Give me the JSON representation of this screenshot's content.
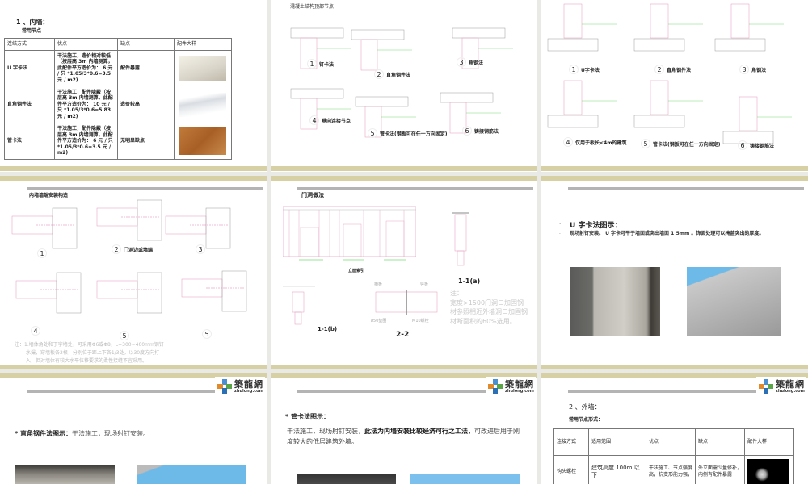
{
  "slides": [
    {
      "title": "1 、内墙：",
      "subtitle": "常用节点",
      "table": {
        "headers": [
          "连结方式",
          "优点",
          "缺点",
          "配件大样"
        ],
        "rows": [
          {
            "method": "U 字卡法",
            "pros": "干法施工，造价相对较低（按层高 3m 内墙测算，此配件平方造价为： 6 元 / 只 *1.05/3*0.6=3.5 元 / m2)",
            "cons": "配件暴露",
            "image": "u-clip"
          },
          {
            "method": "直角钢件法",
            "pros": "干法施工，配件隐蔽（按层高 3m 内墙测算，此配件平方造价为： 10 元 / 只 *1.05/3*0.6=5.83 元 / m2)",
            "cons": "造价较高",
            "image": "angle-steel"
          },
          {
            "method": "管卡法",
            "pros": "干法施工，配件隐蔽（按层高 3m 内墙测算，此配件平方造价为： 6 元 / 只 *1.05/3*0.6=3.5 元 / m2)",
            "cons": "无明显缺点",
            "image": "pipe-clip"
          }
        ]
      }
    },
    {
      "title": "混凝土结构顶部节点：",
      "captions": [
        "1",
        "钉卡法",
        "2",
        "直角钢件法",
        "3",
        "角钢法",
        "4",
        "垂向连接节点",
        "5",
        "管卡法(钢板可在任一方向固定)",
        "6",
        "铸接钢筋法"
      ]
    },
    {
      "captions": [
        "1",
        "U字卡法",
        "2",
        "直角钢件法",
        "3",
        "角钢法",
        "4",
        "仅用于板长<4m的建筑",
        "5",
        "管卡法(钢板可在任一方向固定)",
        "6",
        "铸接钢筋法"
      ]
    },
    {
      "title": "内墙墙端安装构造",
      "captions": [
        "1",
        "2",
        "门洞边或墙端",
        "3",
        "4",
        "5",
        "5"
      ],
      "note": [
        "注：1.墙体角处和丁字墙处，可采用Φ6或Φ8，L=300~400mm钢钉",
        "水撮，穿墙板各2根，分别位于距上下各1/3处，以30度方向打",
        "入，但对墙体有较大水平位移要求的柔性接缝不宜采用。"
      ]
    },
    {
      "title": "门洞做法",
      "elevation": "立面索引",
      "sec_a": "1-1(a)",
      "sec_b": "1-1(b)",
      "sec_c": "2-2",
      "labels": [
        "横板",
        "竖板",
        "ø50垫圈",
        "M10螺栓"
      ],
      "note": [
        "注：",
        "宽度>1500门洞口加固钢",
        "材参照相近外墙洞口加固钢",
        "材断面积的60%选用。"
      ]
    },
    {
      "title": "U 字卡法图示：",
      "body": "现场射钉安装。 U 字卡可平于墙面或突出墙面 1.5mm 。饰面处理可以掩盖突出的厚度。"
    },
    {
      "title": "* 直角钢件法图示：",
      "body": "干法施工，现场射钉安装。"
    },
    {
      "title": "* 管卡法图示：",
      "body_a": "干法施工，现场射钉安装，",
      "body_bold": "此法为内墙安装比较经济可行之工法，",
      "body_b": "可改进后用于刚度较大的低层建筑外墙。"
    },
    {
      "title": "2 、外墙：",
      "subtitle": "常用节点形式：",
      "table": {
        "headers": [
          "连接方式",
          "适用范围",
          "优点",
          "缺点",
          "配件大样"
        ],
        "rows": [
          {
            "method": "钩头螺栓",
            "range": "建筑高度 100m 以下",
            "pros": "干法施工、节点强度高，抗变形能力强，",
            "cons": "外立面需少量修补，内侧有配件暴露",
            "image": "hook-bolt"
          }
        ]
      }
    }
  ],
  "logo": {
    "cn": "築龍網",
    "en": "zhulong.com"
  },
  "colors": {
    "band": "#d6d0a4",
    "rule": "#b4b4b4",
    "pink": "#e27bb0"
  }
}
